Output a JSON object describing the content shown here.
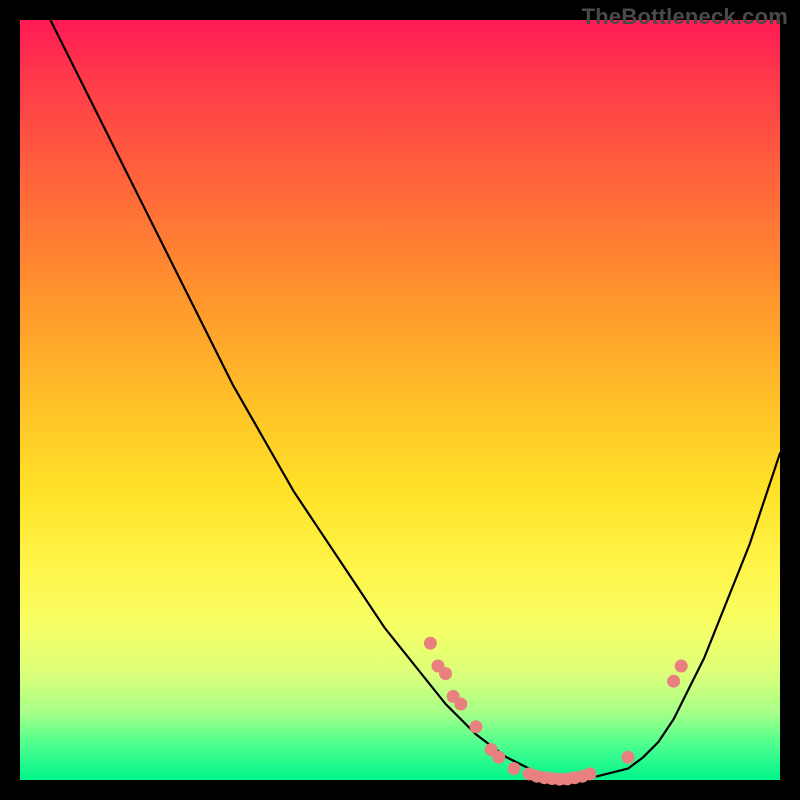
{
  "watermark": "TheBottleneck.com",
  "chart_data": {
    "type": "line",
    "title": "",
    "xlabel": "",
    "ylabel": "",
    "xlim": [
      0,
      100
    ],
    "ylim": [
      0,
      100
    ],
    "grid": false,
    "legend": false,
    "curve": {
      "x": [
        4,
        8,
        12,
        16,
        20,
        24,
        28,
        32,
        36,
        40,
        44,
        48,
        52,
        56,
        60,
        64,
        68,
        72,
        76,
        80,
        82,
        84,
        86,
        88,
        90,
        92,
        94,
        96,
        98,
        100
      ],
      "y": [
        100,
        92,
        84,
        76,
        68,
        60,
        52,
        45,
        38,
        32,
        26,
        20,
        15,
        10,
        6,
        3,
        1,
        0,
        0.5,
        1.5,
        3,
        5,
        8,
        12,
        16,
        21,
        26,
        31,
        37,
        43
      ]
    },
    "dots": [
      {
        "x": 54,
        "y": 18
      },
      {
        "x": 55,
        "y": 15
      },
      {
        "x": 56,
        "y": 14
      },
      {
        "x": 57,
        "y": 11
      },
      {
        "x": 58,
        "y": 10
      },
      {
        "x": 60,
        "y": 7
      },
      {
        "x": 62,
        "y": 4
      },
      {
        "x": 63,
        "y": 3
      },
      {
        "x": 65,
        "y": 1.5
      },
      {
        "x": 67,
        "y": 0.8
      },
      {
        "x": 68,
        "y": 0.5
      },
      {
        "x": 69,
        "y": 0.3
      },
      {
        "x": 70,
        "y": 0.2
      },
      {
        "x": 71,
        "y": 0.1
      },
      {
        "x": 72,
        "y": 0.15
      },
      {
        "x": 73,
        "y": 0.3
      },
      {
        "x": 74,
        "y": 0.5
      },
      {
        "x": 75,
        "y": 0.8
      },
      {
        "x": 80,
        "y": 3
      },
      {
        "x": 86,
        "y": 13
      },
      {
        "x": 87,
        "y": 15
      }
    ],
    "dot_color": "#e98080"
  }
}
